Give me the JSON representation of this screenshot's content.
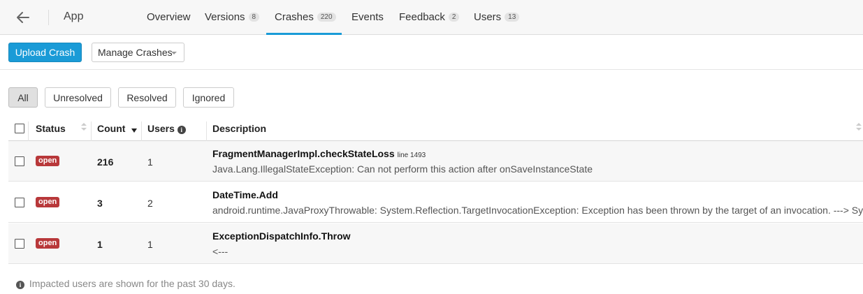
{
  "header": {
    "app_title": "App",
    "tabs": [
      {
        "label": "Overview",
        "badge": ""
      },
      {
        "label": "Versions",
        "badge": "8"
      },
      {
        "label": "Crashes",
        "badge": "220"
      },
      {
        "label": "Events",
        "badge": ""
      },
      {
        "label": "Feedback",
        "badge": "2"
      },
      {
        "label": "Users",
        "badge": "13"
      }
    ],
    "active_tab": "Crashes"
  },
  "toolbar": {
    "upload_label": "Upload Crash",
    "manage_label": "Manage Crashes"
  },
  "filters": [
    "All",
    "Unresolved",
    "Resolved",
    "Ignored"
  ],
  "active_filter": "All",
  "table": {
    "headers": {
      "status": "Status",
      "count": "Count",
      "users": "Users",
      "description": "Description"
    },
    "rows": [
      {
        "status": "open",
        "count": "216",
        "users": "1",
        "title": "FragmentManagerImpl.checkStateLoss",
        "line": "line 1493",
        "detail": "Java.Lang.IllegalStateException: Can not perform this action after onSaveInstanceState"
      },
      {
        "status": "open",
        "count": "3",
        "users": "2",
        "title": "DateTime.Add",
        "line": "",
        "detail": "android.runtime.JavaProxyThrowable: System.Reflection.TargetInvocationException: Exception has been thrown by the target of an invocation. ---> System."
      },
      {
        "status": "open",
        "count": "1",
        "users": "1",
        "title": "ExceptionDispatchInfo.Throw",
        "line": "",
        "detail": "<---"
      }
    ]
  },
  "footnote": "Impacted users are shown for the past 30 days.",
  "colors": {
    "accent": "#1a9bd7",
    "status_open": "#b8383a"
  }
}
